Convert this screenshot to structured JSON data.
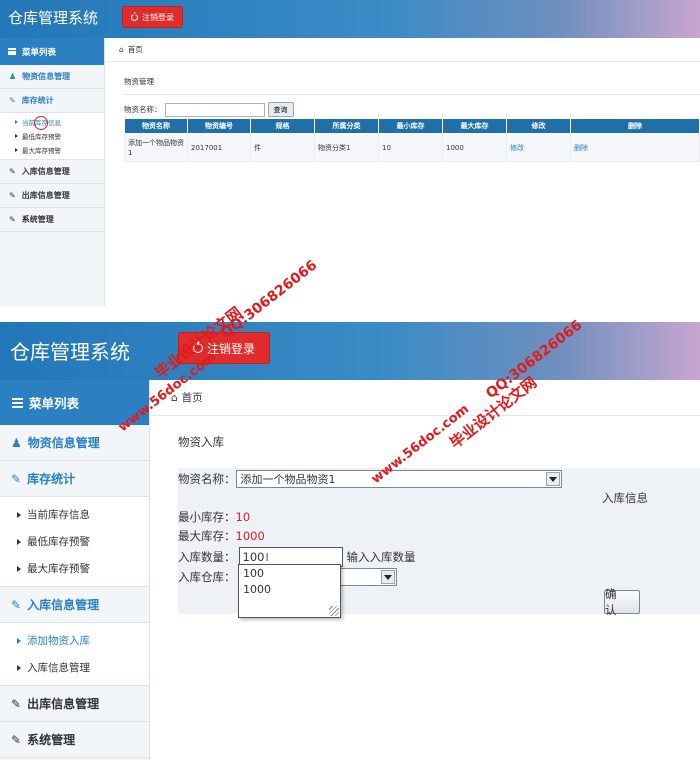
{
  "app": {
    "title": "仓库管理系统",
    "logout_label": "注销登录"
  },
  "sidebar": {
    "header": "菜单列表",
    "items": [
      {
        "label": "物资信息管理"
      },
      {
        "label": "库存统计",
        "sub": [
          "当前库存信息",
          "最低库存预警",
          "最大库存预警"
        ]
      },
      {
        "label": "入库信息管理",
        "sub": [
          "添加物资入库",
          "入库信息管理"
        ]
      },
      {
        "label": "出库信息管理"
      },
      {
        "label": "系统管理"
      }
    ]
  },
  "breadcrumb": {
    "home": "首页"
  },
  "screen1": {
    "section_title": "物资管理",
    "search": {
      "label": "物资名称：",
      "value": "",
      "button": "查询"
    },
    "table": {
      "headers": [
        "物资名称",
        "物资编号",
        "规格",
        "所属分类",
        "最小库存",
        "最大库存",
        "修改",
        "删除"
      ],
      "rows": [
        [
          "添加一个物品物资1",
          "2017001",
          "件",
          "物资分类1",
          "10",
          "1000",
          "修改",
          "删除"
        ]
      ]
    }
  },
  "screen2": {
    "section_title": "物资入库",
    "info_label": "入库信息",
    "fields": {
      "name_label": "物资名称：",
      "name_value": "添加一个物品物资1",
      "min_label": "最小库存：",
      "min_value": "10",
      "max_label": "最大库存：",
      "max_value": "1000",
      "qty_label": "入库数量：",
      "qty_value": "100",
      "qty_hint": "输入入库数量",
      "warehouse_label": "入库仓库：",
      "warehouse_value": ""
    },
    "autocomplete": [
      "100",
      "1000"
    ],
    "confirm": "确 认"
  },
  "watermark": {
    "site": "www.56doc.com",
    "qq": "QQ:306826066",
    "name": "毕业设计论文网"
  },
  "colors": {
    "header_blue": "#2277b8",
    "menu_blue": "#2a80c0",
    "table_head": "#1f6fa9",
    "logout_red": "#e02c2c",
    "value_red": "#d62020"
  }
}
